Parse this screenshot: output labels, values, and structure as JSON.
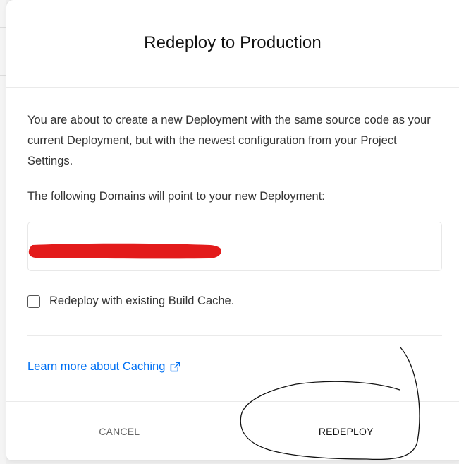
{
  "modal": {
    "title": "Redeploy to Production",
    "description": "You are about to create a new Deployment with the same source code as your current Deployment, but with the newest configuration from your Project Settings.",
    "domains_intro": "The following Domains will point to your new Deployment:",
    "checkbox_label": "Redeploy with existing Build Cache.",
    "checkbox_checked": false,
    "learn_more_link": "Learn more about Caching",
    "cancel_label": "CANCEL",
    "redeploy_label": "REDEPLOY"
  },
  "icons": {
    "external_link": "external-link-icon"
  },
  "colors": {
    "link": "#0070f3",
    "redaction": "#e31b1b",
    "title": "#111111",
    "body_text": "#333333"
  }
}
